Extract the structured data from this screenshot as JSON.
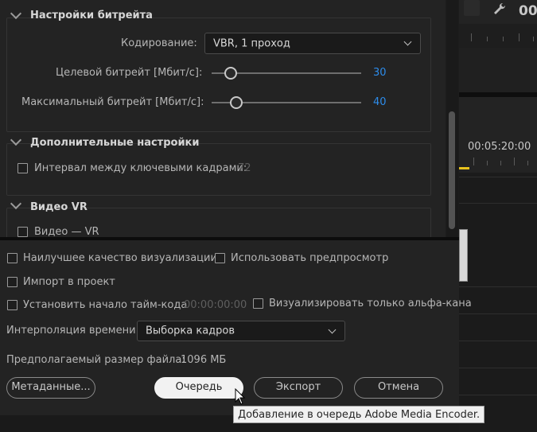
{
  "bitrate_section": {
    "title": "Настройки битрейта",
    "encoding_label": "Кодирование:",
    "encoding_value": "VBR, 1 проход",
    "target_label": "Целевой битрейт [Мбит/с]:",
    "target_value": "30",
    "target_level": 0.16,
    "max_label": "Максимальный битрейт [Мбит/с]:",
    "max_value": "40",
    "max_level": 0.2
  },
  "advanced_section": {
    "title": "Дополнительные настройки",
    "keyframe_label": "Интервал между ключевыми кадрами:",
    "keyframe_value": "72"
  },
  "vr_section": {
    "title": "Видео VR",
    "vr_checkbox_label": "Видео — VR"
  },
  "options": {
    "best_quality": "Наилучшее качество визуализации",
    "use_preview": "Использовать предпросмотр",
    "import_project": "Импорт в проект",
    "set_timecode": "Установить начало тайм-кода",
    "timecode_value": "00:00:00:00",
    "alpha_only": "Визуализировать только альфа-кана",
    "interp_label": "Интерполяция времени:",
    "interp_value": "Выборка кадров",
    "file_size_label": "Предполагаемый размер файла:",
    "file_size_value": "1096 МБ"
  },
  "buttons": {
    "metadata": "Метаданные...",
    "queue": "Очередь",
    "export": "Экспорт",
    "cancel": "Отмена"
  },
  "tooltip": "Добавление в очередь Adobe Media Encoder.",
  "timeline": {
    "timecode": "00:05:20:00",
    "top_counter": "00"
  },
  "colors": {
    "accent_blue": "#2d8ceb",
    "playhead_yellow": "#e8c21c"
  }
}
